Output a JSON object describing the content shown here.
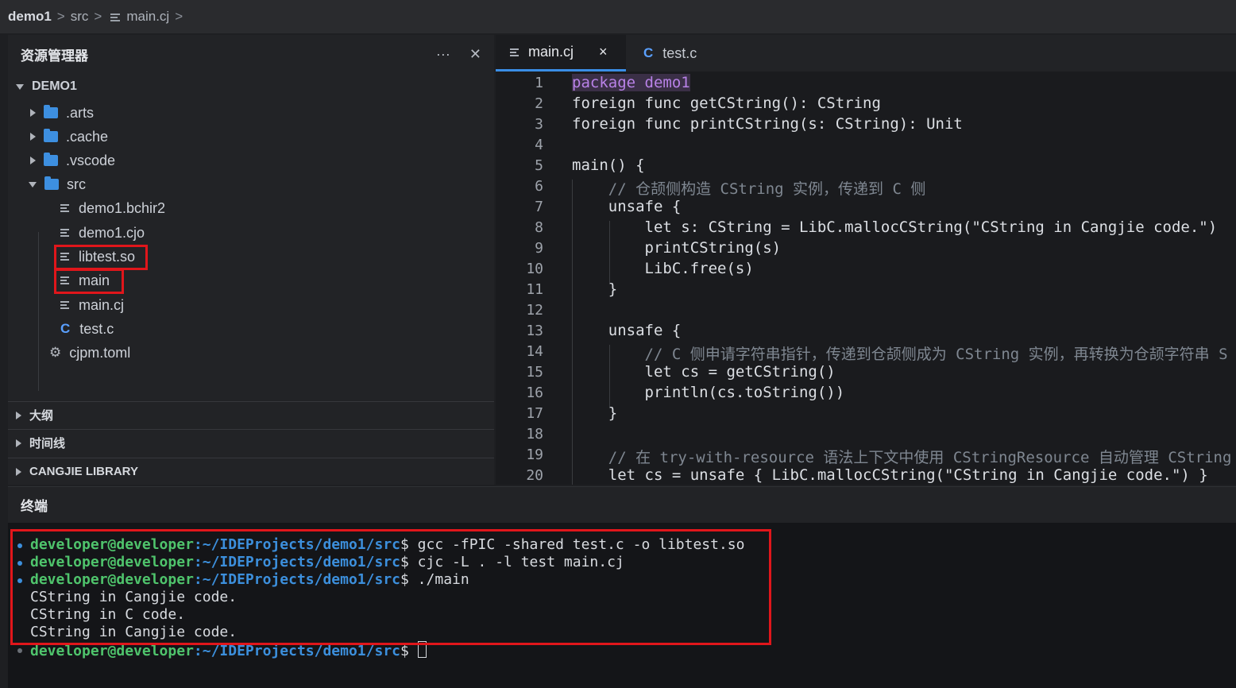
{
  "breadcrumb": [
    "demo1",
    "src",
    "main.cj"
  ],
  "explorer": {
    "title": "资源管理器",
    "more_icon": "ellipsis-icon",
    "close_icon": "close-icon",
    "root": "DEMO1",
    "items": [
      {
        "label": ".arts",
        "kind": "folder",
        "expanded": false
      },
      {
        "label": ".cache",
        "kind": "folder",
        "expanded": false
      },
      {
        "label": ".vscode",
        "kind": "folder",
        "expanded": false
      },
      {
        "label": "src",
        "kind": "folder",
        "expanded": true
      },
      {
        "label": "demo1.bchir2",
        "kind": "file"
      },
      {
        "label": "demo1.cjo",
        "kind": "file"
      },
      {
        "label": "libtest.so",
        "kind": "file",
        "highlighted": true
      },
      {
        "label": "main",
        "kind": "file",
        "highlighted": true
      },
      {
        "label": "main.cj",
        "kind": "file"
      },
      {
        "label": "test.c",
        "kind": "c-file"
      },
      {
        "label": "cjpm.toml",
        "kind": "config"
      }
    ],
    "sections": [
      "大纲",
      "时间线",
      "CANGJIE LIBRARY"
    ]
  },
  "tabs": [
    {
      "label": "main.cj",
      "active": true,
      "close": "×"
    },
    {
      "label": "test.c",
      "active": false,
      "icon_text": "C"
    }
  ],
  "editor": {
    "line_numbers": [
      "1",
      "2",
      "3",
      "4",
      "5",
      "6",
      "7",
      "8",
      "9",
      "10",
      "11",
      "12",
      "13",
      "14",
      "15",
      "16",
      "17",
      "18",
      "19",
      "20"
    ],
    "lines": [
      "package demo1",
      "foreign func getCString(): CString",
      "foreign func printCString(s: CString): Unit",
      "",
      "main() {",
      "    // 仓颉侧构造 CString 实例，传递到 C 侧",
      "    unsafe {",
      "        let s: CString = LibC.mallocCString(\"CString in Cangjie code.\")",
      "        printCString(s)",
      "        LibC.free(s)",
      "    }",
      "",
      "    unsafe {",
      "        // C 侧申请字符串指针，传递到仓颉侧成为 CString 实例，再转换为仓颉字符串 S",
      "        let cs = getCString()",
      "        println(cs.toString())",
      "    }",
      "",
      "    // 在 try-with-resource 语法上下文中使用 CStringResource 自动管理 CString",
      "    let cs = unsafe { LibC.mallocCString(\"CString in Cangjie code.\") }"
    ]
  },
  "terminal": {
    "title": "终端",
    "user": "developer@developer",
    "path": ":~/IDEProjects/demo1/src",
    "prompt_char": "$",
    "commands": [
      " gcc -fPIC -shared test.c -o libtest.so",
      " cjc -L . -l test main.cj",
      " ./main"
    ],
    "outputs": [
      "CString in Cangjie code.",
      "CString in C code.",
      "CString in Cangjie code."
    ]
  },
  "colors": {
    "highlight_box": "#e0161b",
    "accent": "#3a8ee6"
  }
}
